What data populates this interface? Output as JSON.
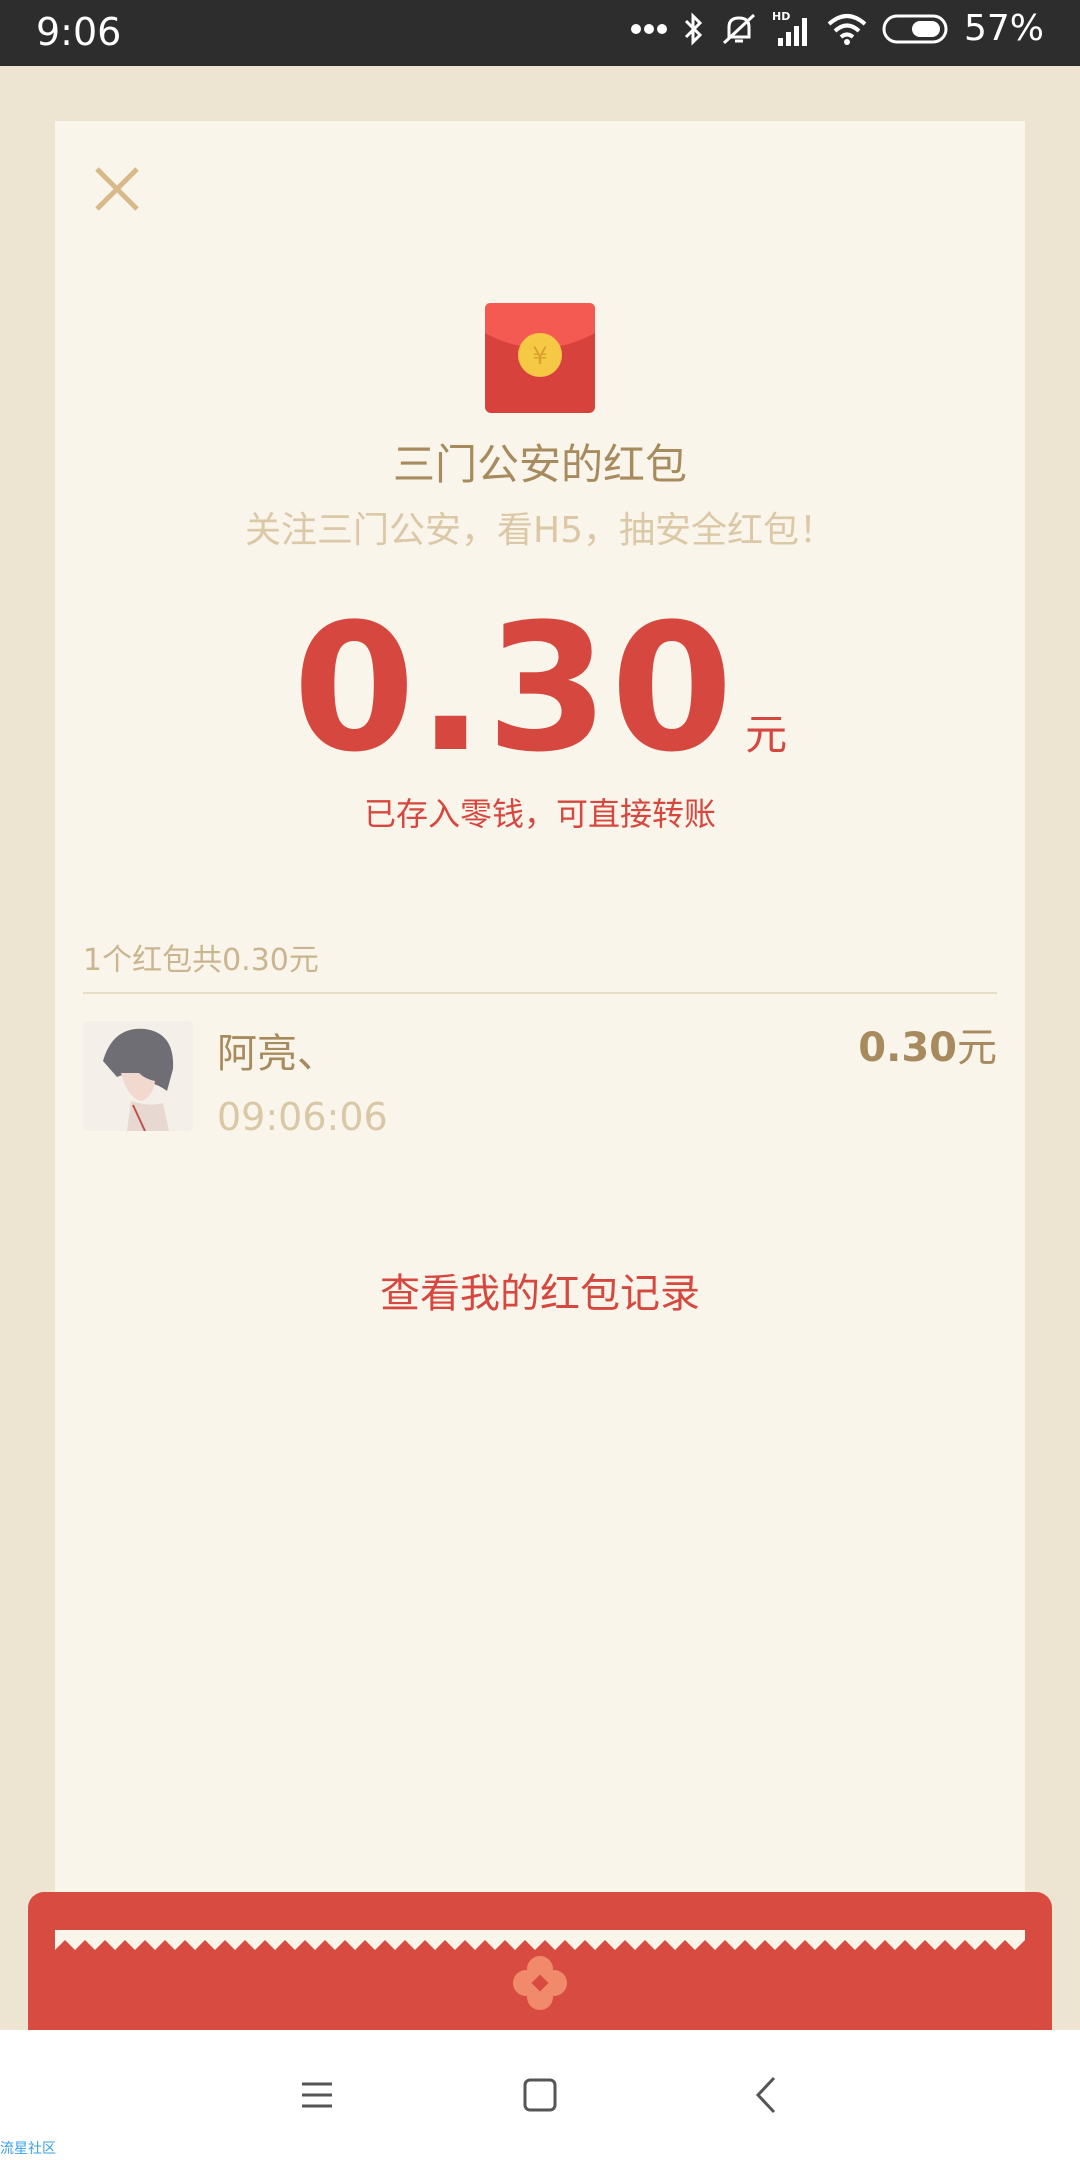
{
  "status_bar": {
    "time": "9:06",
    "battery_percent": "57%",
    "icons": [
      "more-dots-icon",
      "bluetooth-icon",
      "mute-icon",
      "hd-signal-icon",
      "wifi-icon",
      "battery-icon"
    ]
  },
  "close_icon": "close-icon",
  "red_packet": {
    "sender_title": "三门公安的红包",
    "wish": "关注三门公安，看H5，抽安全红包！",
    "amount": "0.30",
    "unit": "元",
    "saved_note": "已存入零钱，可直接转账",
    "envelope_coin": "¥"
  },
  "summary": "1个红包共0.30元",
  "recipients": [
    {
      "name": "阿亮、",
      "time": "09:06:06",
      "amount": "0.30",
      "unit": "元"
    }
  ],
  "history_link": "查看我的红包记录",
  "nav": [
    "menu-icon",
    "home-icon",
    "back-icon"
  ],
  "watermark": "流星社区",
  "colors": {
    "accent_red": "#d6473f",
    "gold": "#a78b5f",
    "card_bg": "#faf5ea",
    "page_bg": "#ede5d2"
  }
}
